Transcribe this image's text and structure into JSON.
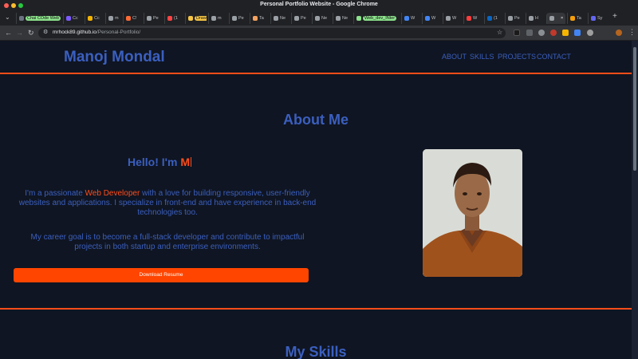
{
  "window": {
    "title": "Personal Portfolio Website - Google Chrome"
  },
  "tabs": [
    {
      "label": "Chai COde Web",
      "chip_color": "#8ce38c"
    },
    {
      "label": "Cc"
    },
    {
      "label": "Cc"
    },
    {
      "label": "m"
    },
    {
      "label": "C!"
    },
    {
      "label": "Pe"
    },
    {
      "label": "(1"
    },
    {
      "label": "Draw",
      "chip_color": "#f6c544"
    },
    {
      "label": "m"
    },
    {
      "label": "Pe"
    },
    {
      "label": "Ta"
    },
    {
      "label": "Ne"
    },
    {
      "label": "Pe"
    },
    {
      "label": "Ne"
    },
    {
      "label": "Ne"
    },
    {
      "label": "Web_dev_INter",
      "chip_color": "#8ce38c"
    },
    {
      "label": "W"
    },
    {
      "label": "W"
    },
    {
      "label": "W"
    },
    {
      "label": "W"
    },
    {
      "label": "(1"
    },
    {
      "label": "Pe"
    },
    {
      "label": "H"
    },
    {
      "label": "",
      "active": true
    },
    {
      "label": "Ta"
    },
    {
      "label": "Sy"
    }
  ],
  "browser": {
    "url_host": "mrhock89.github.io",
    "url_path": "/Personal-Portfolio/",
    "new_tab_symbol": "+",
    "close_tab_symbol": "×"
  },
  "site": {
    "logo": "Manoj Mondal",
    "nav": [
      "ABOUT",
      "SKILLS",
      "PROJECTS",
      "CONTACT"
    ]
  },
  "about": {
    "title": "About Me",
    "greeting": "Hello! I'm ",
    "typed_text": "M",
    "intro_before": "I'm a passionate ",
    "intro_highlight": "Web Developer",
    "intro_after": " with a love for building responsive, user-friendly websites and applications. I specialize in front-end and have experience in back-end technologies too.",
    "goal": "My career goal is to become a full-stack developer and contribute to impactful projects in both startup and enterprise environments.",
    "download_label": "Download Resume"
  },
  "skills": {
    "title": "My Skills"
  },
  "colors": {
    "accent": "#ff4d1a",
    "heading": "#3b5fbf",
    "background": "#0f1522",
    "button": "#ff4500"
  },
  "icons": [
    "back-arrow-icon",
    "forward-arrow-icon",
    "reload-icon",
    "site-info-icon",
    "bookmark-star-icon",
    "extensions-icon",
    "profile-avatar-icon",
    "menu-dots-icon",
    "tab-search-icon"
  ]
}
